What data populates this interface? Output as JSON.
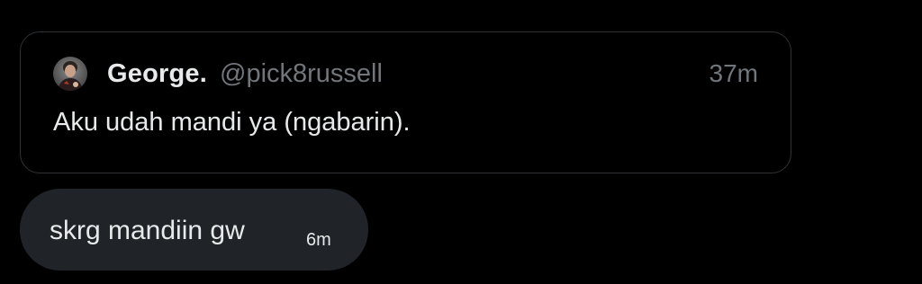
{
  "quoted_post": {
    "author_name": "George.",
    "author_handle": "@pick8russell",
    "timestamp": "37m",
    "text": "Aku udah mandi ya (ngabarin).",
    "avatar_icon": "user-avatar-photo"
  },
  "message": {
    "text": "skrg mandiin gw",
    "timestamp": "6m"
  },
  "colors": {
    "background": "#000000",
    "card_border": "#2f3336",
    "bubble_bg": "#202327",
    "primary_text": "#e7e9ea",
    "secondary_text": "#71767b"
  }
}
